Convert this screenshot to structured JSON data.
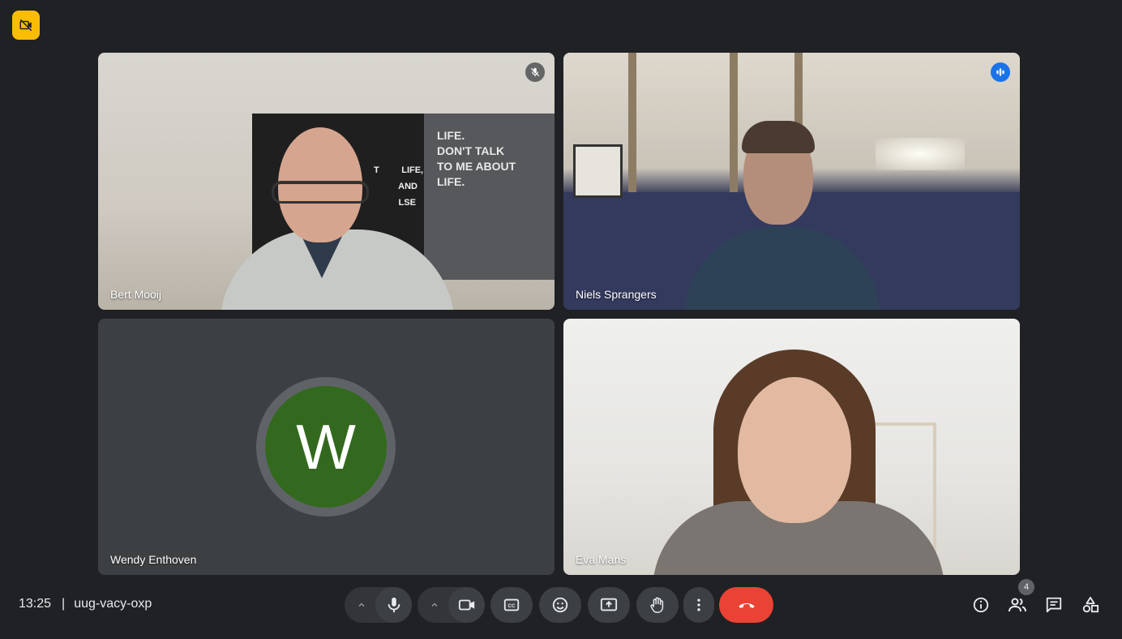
{
  "participants": [
    {
      "name": "Bert Mooij",
      "status_icon": "mic-off-icon",
      "poster_left_text": "T         LIFE,\n          AND\n          LSE",
      "poster_right_text": "LIFE.\nDON'T TALK\nTO ME ABOUT\nLIFE."
    },
    {
      "name": "Niels Sprangers",
      "status_icon": "speaking-indicator-icon",
      "active_speaker": true
    },
    {
      "name": "Wendy Enthoven",
      "avatar_letter": "W",
      "avatar_color": "#33691e"
    },
    {
      "name": "Eva Mans"
    }
  ],
  "meeting": {
    "time": "13:25",
    "separator": "|",
    "code": "uug-vacy-oxp"
  },
  "controls": {
    "people_count": "4",
    "end_call_color": "#ea4335",
    "accent_color": "#8ab4f8",
    "badge_color": "#fbbc04"
  }
}
